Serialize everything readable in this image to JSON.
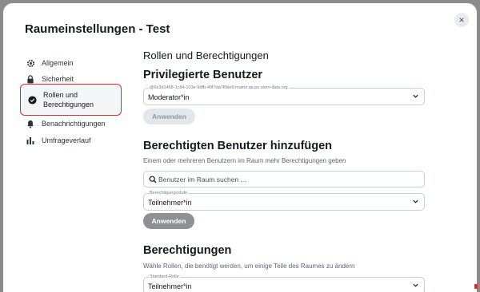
{
  "dialog": {
    "title": "Raumeinstellungen - Test",
    "close": "×"
  },
  "sidebar": {
    "items": [
      {
        "label": "Allgemein",
        "icon": "gear-icon"
      },
      {
        "label": "Sicherheit",
        "icon": "lock-icon"
      },
      {
        "label_line1": "Rollen und",
        "label_line2": "Berechtigungen",
        "icon": "shield-check-icon"
      },
      {
        "label": "Benachrichtigungen",
        "icon": "bell-icon"
      },
      {
        "label": "Umfrageverlauf",
        "icon": "chart-icon"
      }
    ]
  },
  "main": {
    "heading": "Rollen und Berechtigungen",
    "privileged": {
      "title": "Privilegierte Benutzer",
      "select_label": "@6c3d1468-1c84-103e-9dfb-49f7da7f0be9:matrix.qa.ps.oxen-data.org",
      "select_value": "Moderator*in",
      "apply": "Anwenden"
    },
    "add_privileged": {
      "title": "Berechtigten Benutzer hinzufügen",
      "description": "Einem oder mehreren Benutzern im Raum mehr Berechtigungen geben",
      "search_placeholder": "Benutzer im Raum suchen ...",
      "select_label": "Berechtigungsstufe",
      "select_value": "Teilnehmer*in",
      "apply": "Anwenden"
    },
    "permissions": {
      "title": "Berechtigungen",
      "description": "Wähle Rollen, die benötigt werden, um einige Teile des Raumes zu ändern",
      "select_label": "Standard-Rolle",
      "select_value": "Teilnehmer*in"
    }
  }
}
